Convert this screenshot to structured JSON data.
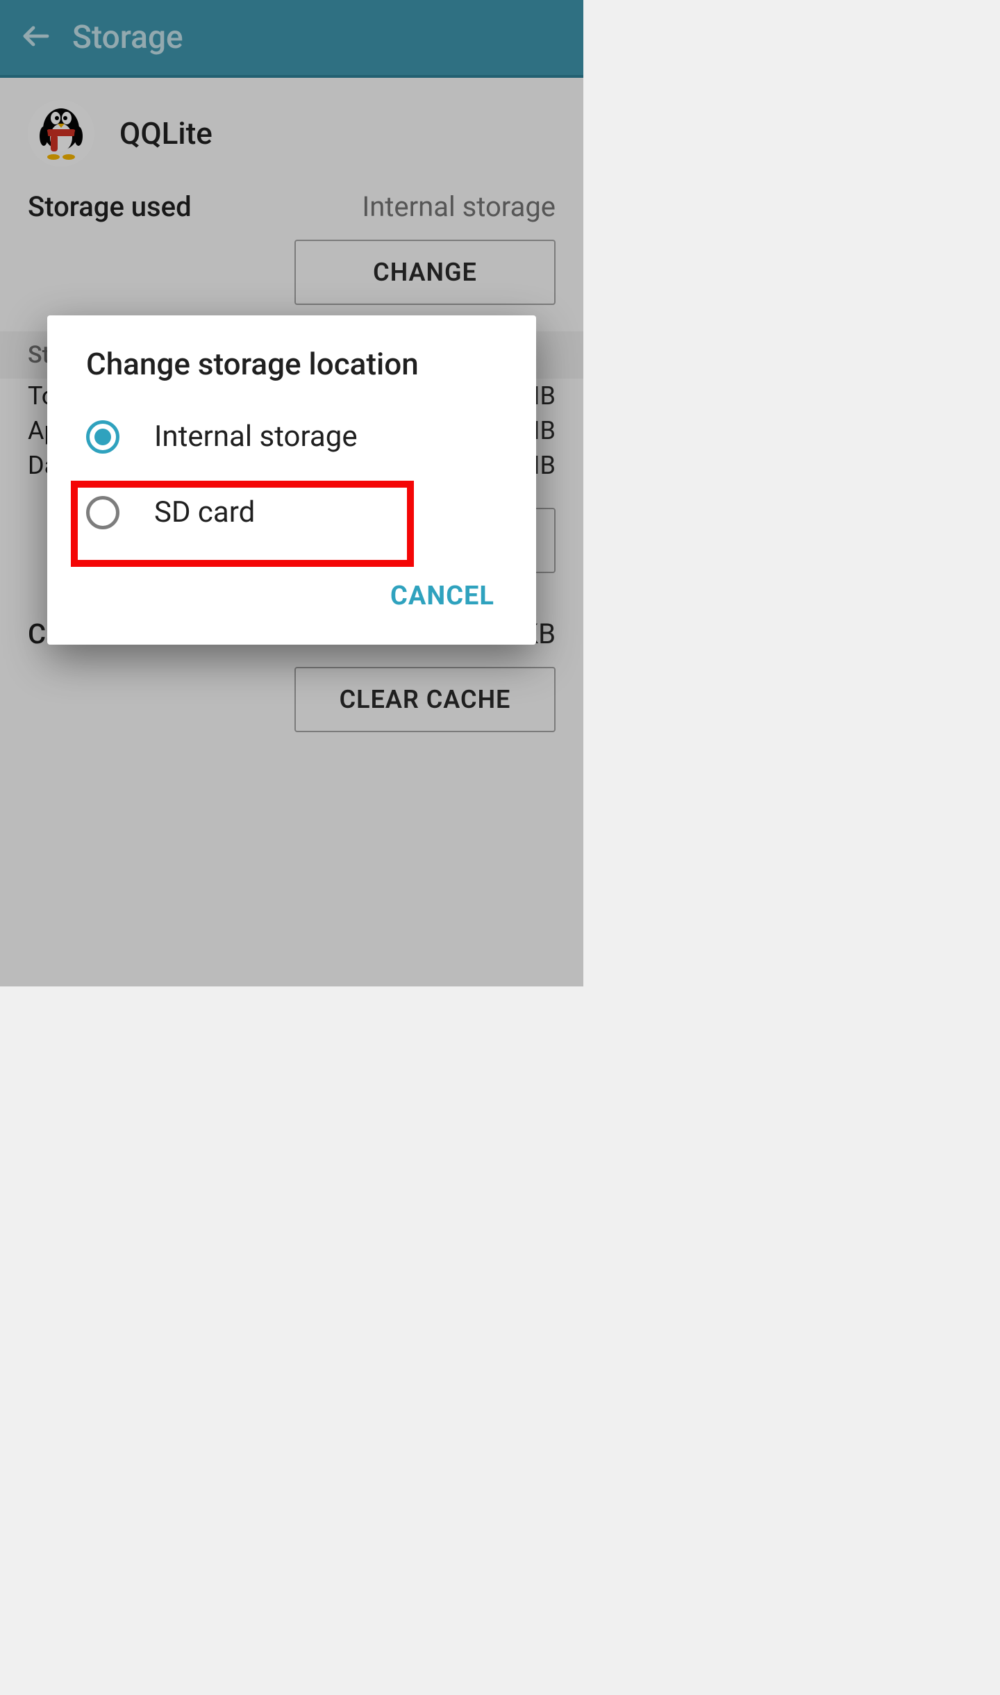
{
  "appbar": {
    "title": "Storage"
  },
  "app": {
    "name": "QQLite"
  },
  "storage_used": {
    "label": "Storage used",
    "value": "Internal storage",
    "change_button": "CHANGE"
  },
  "section_header": "Space used",
  "rows": {
    "total": {
      "label": "Total",
      "value_suffix": "IB"
    },
    "app": {
      "label": "App",
      "value_suffix": "IB"
    },
    "data": {
      "label": "Data",
      "value_suffix": "IB"
    }
  },
  "cache": {
    "label": "Cache",
    "value_suffix": "KB",
    "clear_button": "CLEAR CACHE"
  },
  "dialog": {
    "title": "Change storage location",
    "option_internal": "Internal storage",
    "option_sd": "SD card",
    "cancel": "CANCEL",
    "selected_index": 0
  }
}
